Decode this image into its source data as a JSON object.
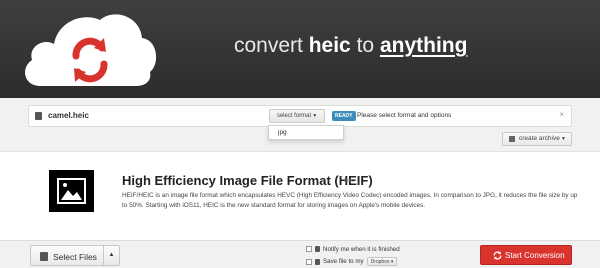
{
  "header": {
    "headline_prefix": "convert",
    "headline_source": "heic",
    "headline_mid": "to",
    "headline_target": "anything",
    "logo_icon": "cloud-sync-icon"
  },
  "file": {
    "name": "camel.heic",
    "select_label": "select format",
    "ready_badge": "READY",
    "status": "Please select format and options",
    "close": "×",
    "dropdown_options": [
      "jpg"
    ]
  },
  "archive": {
    "label": "create archive"
  },
  "format": {
    "title": "High Efficiency Image File Format (HEIF)",
    "ext": "heic",
    "description": "HEIF/HEIC is an image file format which encapsulates HEVC (High Efficiency Video Codec) encoded images. In comparison to JPG, it reduces the file size by up to 50%. Starting with iOS11, HEIC is the new standard format for storing images on Apple's mobile devices."
  },
  "bottom": {
    "select_files": "Select Files",
    "notify": "Notify me when it is finished",
    "save_prefix": "Save file to my",
    "dropbox": "Dropbox",
    "start": "Start Conversion"
  },
  "colors": {
    "header_bg": "#333333",
    "accent_red": "#d9332d",
    "ready_blue": "#3c8dbc"
  }
}
